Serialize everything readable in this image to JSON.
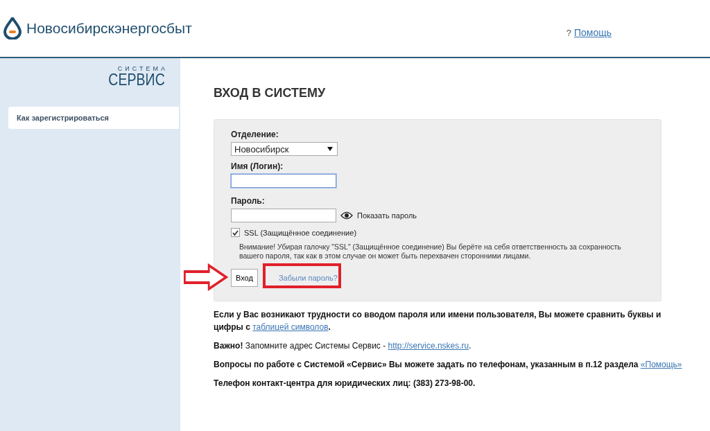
{
  "header": {
    "brand": "Новосибирскэнергосбыт",
    "help_mark": "?",
    "help_link": "Помощь"
  },
  "sidebar": {
    "logo_top": "СИСТЕМА",
    "logo_bottom": "СЕРВИС",
    "items": [
      {
        "label": "Как зарегистрироваться",
        "selected": false
      }
    ]
  },
  "page_title": "ВХОД В СИСТЕМУ",
  "form": {
    "branch_label": "Отделение:",
    "branch_value": "Новосибирск",
    "login_label": "Имя (Логин):",
    "login_focused": true,
    "password_label": "Пароль:",
    "show_password": "Показать пароль",
    "ssl": {
      "label": "SSL (Защищённое соединение)",
      "checked": true
    },
    "warning": "Внимание! Убирая галочку \"SSL\" (Защищённое соединение) Вы берёте на себя ответственность за сохранность вашего пароля, так как в этом случае он может быть перехвачен сторонними лицами.",
    "submit": "Вход",
    "forgot": "Забыли пароль?",
    "highlight_forgot": true
  },
  "notes": [
    {
      "segments": [
        {
          "kind": "bold",
          "text": "Если у Вас возникают трудности со вводом пароля или имени пользователя, Вы можете сравнить буквы и цифры с "
        },
        {
          "kind": "link",
          "text": "таблицей символов"
        },
        {
          "kind": "bold",
          "text": "."
        }
      ]
    },
    {
      "segments": [
        {
          "kind": "bold",
          "text": "Важно!"
        },
        {
          "kind": "plain",
          "text": " Запомните адрес Системы Сервис - "
        },
        {
          "kind": "link",
          "text": "http://service.nskes.ru"
        },
        {
          "kind": "plain",
          "text": "."
        }
      ]
    },
    {
      "segments": [
        {
          "kind": "bold",
          "text": "Вопросы по работе с Системой «Сервис» Вы можете задать по телефонам, указанным в п.12 раздела "
        },
        {
          "kind": "link",
          "text": "«Помощь»"
        }
      ]
    },
    {
      "segments": [
        {
          "kind": "bold",
          "text": "Телефон контакт-центра для юридических лиц: (383) 273-98-00."
        }
      ]
    }
  ]
}
